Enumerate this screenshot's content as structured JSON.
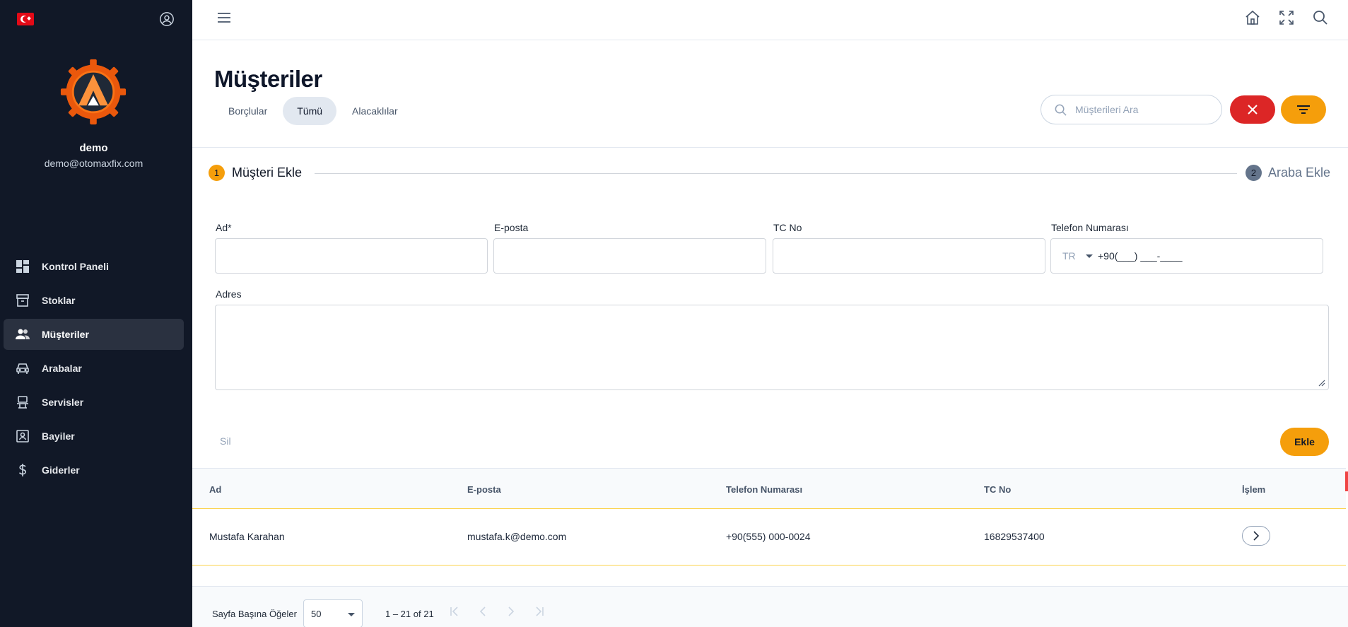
{
  "sidebar": {
    "username": "demo",
    "email": "demo@otomaxfix.com",
    "items": [
      {
        "label": "Kontrol Paneli",
        "icon": "dashboard-icon",
        "active": false
      },
      {
        "label": "Stoklar",
        "icon": "archive-box-icon",
        "active": false
      },
      {
        "label": "Müşteriler",
        "icon": "users-icon",
        "active": true
      },
      {
        "label": "Arabalar",
        "icon": "car-icon",
        "active": false
      },
      {
        "label": "Servisler",
        "icon": "service-icon",
        "active": false
      },
      {
        "label": "Bayiler",
        "icon": "dealer-icon",
        "active": false
      },
      {
        "label": "Giderler",
        "icon": "dollar-icon",
        "active": false
      }
    ]
  },
  "header": {
    "title": "Müşteriler",
    "tabs": [
      {
        "label": "Borçlular",
        "active": false
      },
      {
        "label": "Tümü",
        "active": true
      },
      {
        "label": "Alacaklılar",
        "active": false
      }
    ],
    "search_placeholder": "Müşterileri Ara"
  },
  "stepper": {
    "step1_num": "1",
    "step1_label": "Müşteri Ekle",
    "step2_num": "2",
    "step2_label": "Araba Ekle"
  },
  "form": {
    "name_label": "Ad*",
    "email_label": "E-posta",
    "tc_label": "TC No",
    "phone_label": "Telefon Numarası",
    "phone_country": "TR",
    "phone_mask": "+90(___) ___-____",
    "address_label": "Adres",
    "delete_label": "Sil",
    "add_label": "Ekle"
  },
  "table": {
    "columns": [
      "Ad",
      "E-posta",
      "Telefon Numarası",
      "TC No",
      "İşlem"
    ],
    "rows": [
      {
        "name": "Mustafa Karahan",
        "email": "mustafa.k@demo.com",
        "phone": "+90(555) 000-0024",
        "tc": "16829537400"
      }
    ]
  },
  "paginator": {
    "items_per_page_label": "Sayfa Başına Öğeler",
    "page_size": "50",
    "range": "1 – 21 of 21"
  },
  "colors": {
    "accent": "#f59e0b",
    "danger": "#dc2626",
    "sidebar_bg": "#111827"
  }
}
